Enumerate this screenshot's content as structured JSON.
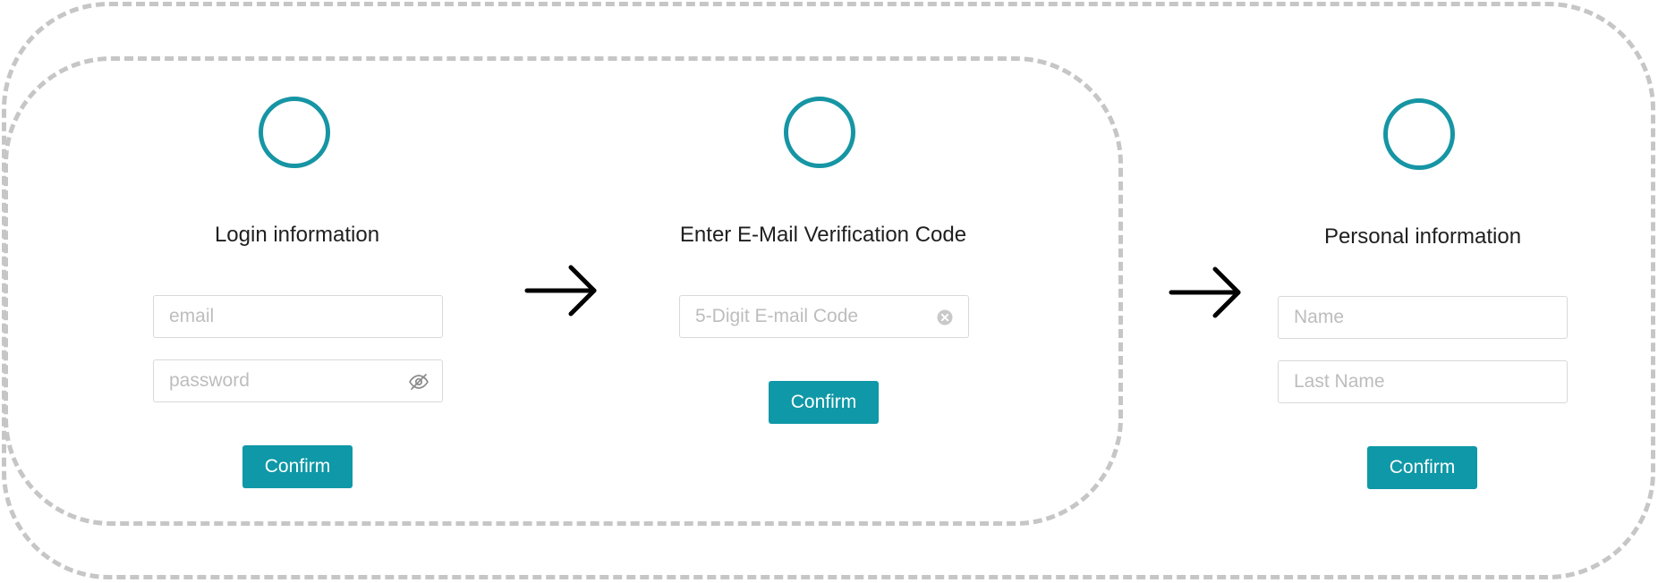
{
  "steps": [
    {
      "title": "Login information",
      "fields": [
        {
          "placeholder": "email",
          "value": "",
          "icon": null
        },
        {
          "placeholder": "password",
          "value": "",
          "icon": "eye-slash-icon"
        }
      ],
      "button_label": "Confirm"
    },
    {
      "title": "Enter E-Mail Verification Code",
      "fields": [
        {
          "placeholder": "5-Digit E-mail Code",
          "value": "",
          "icon": "clear-icon"
        }
      ],
      "button_label": "Confirm"
    },
    {
      "title": "Personal information",
      "fields": [
        {
          "placeholder": "Name",
          "value": "",
          "icon": null
        },
        {
          "placeholder": "Last Name",
          "value": "",
          "icon": null
        }
      ],
      "button_label": "Confirm"
    }
  ],
  "colors": {
    "accent": "#1695a4",
    "button": "#0f98a7",
    "frame_dash": "#c6c6c6",
    "field_border": "#d9d9d9",
    "placeholder": "#bdbdbd",
    "arrow": "#000000"
  }
}
